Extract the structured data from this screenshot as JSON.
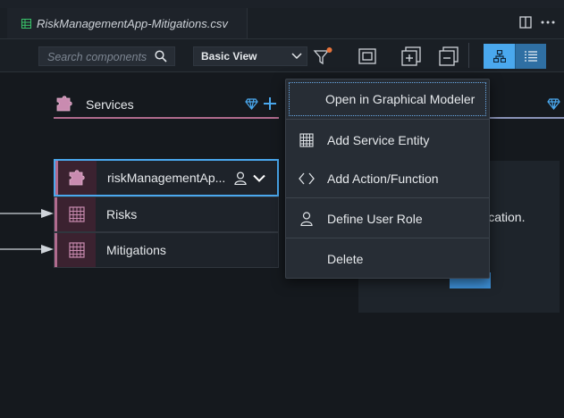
{
  "tab": {
    "title": "RiskManagementApp-Mitigations.csv"
  },
  "toolbar": {
    "search_placeholder": "Search components",
    "view_select": "Basic View"
  },
  "services_column": {
    "title": "Services"
  },
  "service": {
    "name": "riskManagementAp...",
    "entities": [
      "Risks",
      "Mitigations"
    ]
  },
  "right_panel": {
    "text": "lication."
  },
  "context_menu": {
    "items": [
      "Open in Graphical Modeler",
      "Add Service Entity",
      "Add Action/Function",
      "Define User Role",
      "Delete"
    ]
  },
  "colors": {
    "accent": "#4aa8ee",
    "service": "#b06b8e"
  }
}
